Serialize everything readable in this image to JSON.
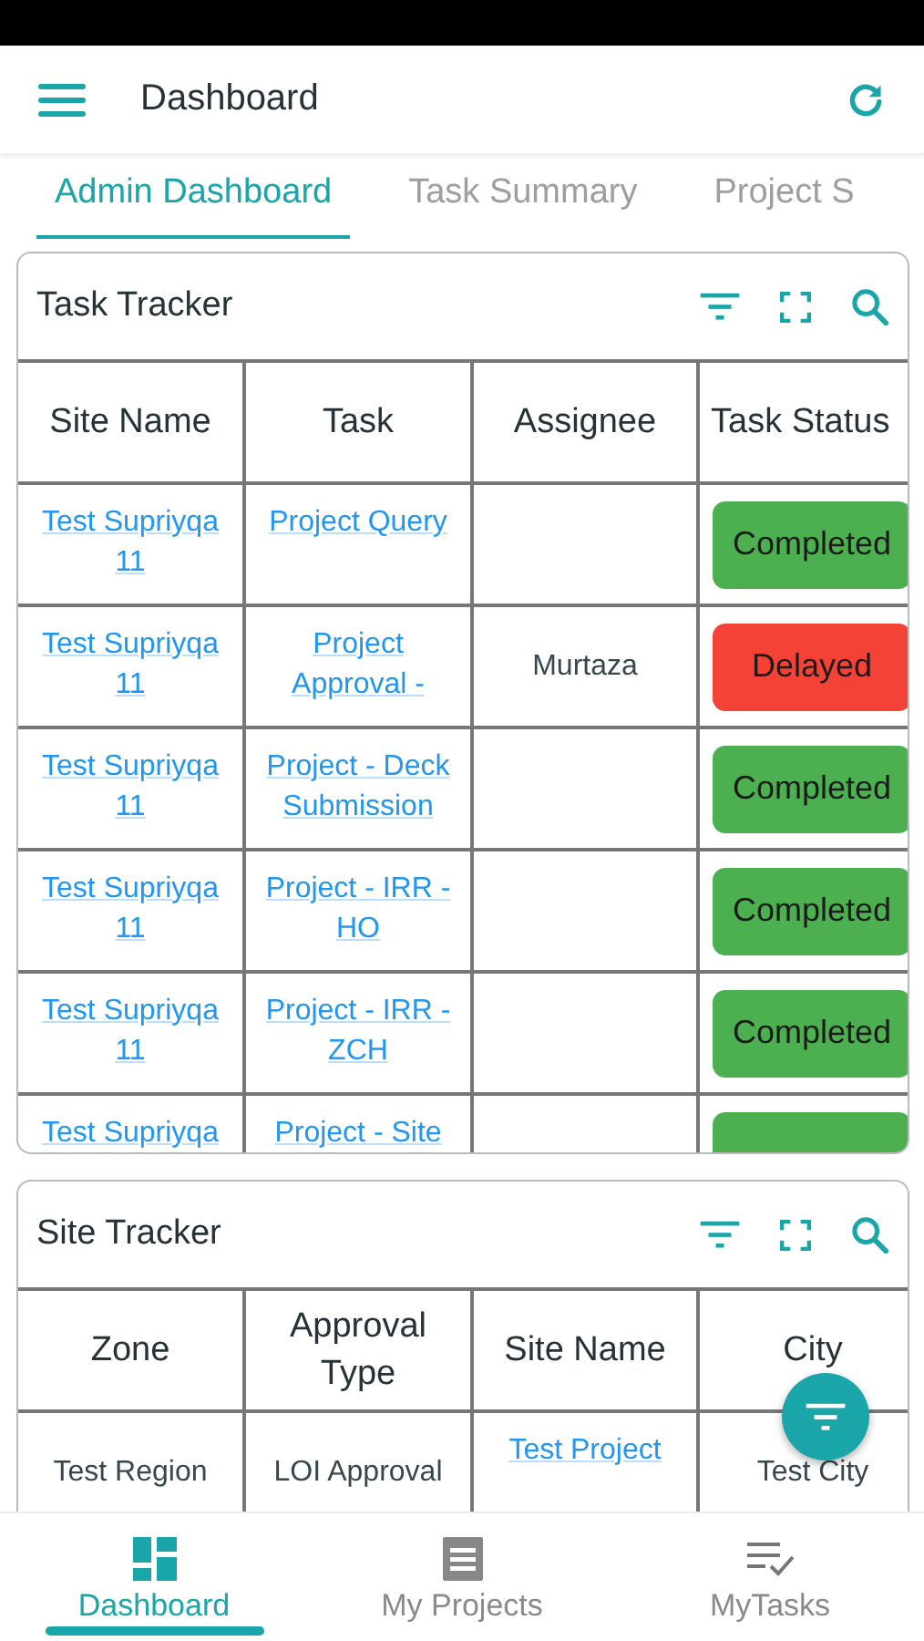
{
  "app_bar": {
    "title": "Dashboard"
  },
  "tabs": [
    {
      "label": "Admin Dashboard",
      "selected": true
    },
    {
      "label": "Task Summary",
      "selected": false
    },
    {
      "label": "Project S",
      "selected": false
    }
  ],
  "task_tracker": {
    "title": "Task Tracker",
    "columns": [
      "Site Name",
      "Task",
      "Assignee",
      "Task Status"
    ],
    "rows": [
      {
        "site": "Test Supriyqa 11",
        "task": "Project Query",
        "status": "Completed",
        "color": "#4caf50"
      },
      {
        "site": "Test Supriyqa 11",
        "task": "Project Approval -",
        "assignee": "Murtaza",
        "status": "Delayed",
        "color": "#f44336"
      },
      {
        "site": "Test Supriyqa 11",
        "task": "Project - Deck Submission",
        "status": "Completed",
        "color": "#4caf50"
      },
      {
        "site": "Test Supriyqa 11",
        "task": "Project - IRR - HO",
        "status": "Completed",
        "color": "#4caf50"
      },
      {
        "site": "Test Supriyqa 11",
        "task": "Project - IRR - ZCH",
        "status": "Completed",
        "color": "#4caf50"
      },
      {
        "site": "Test Supriyqa",
        "task": "Project - Site",
        "color": "#4caf50"
      }
    ]
  },
  "site_tracker": {
    "title": "Site Tracker",
    "columns": [
      "Zone",
      "Approval Type",
      "Site Name",
      "City"
    ],
    "rows": [
      {
        "zone": "Test Region",
        "approval": "LOI Approval",
        "site": "Test Project",
        "city": "Test City"
      }
    ]
  },
  "bottom_nav": [
    {
      "label": "Dashboard",
      "kind": "dashboard",
      "selected": true
    },
    {
      "label": "My Projects",
      "kind": "projects",
      "selected": false
    },
    {
      "label": "MyTasks",
      "kind": "tasks",
      "selected": false
    }
  ]
}
